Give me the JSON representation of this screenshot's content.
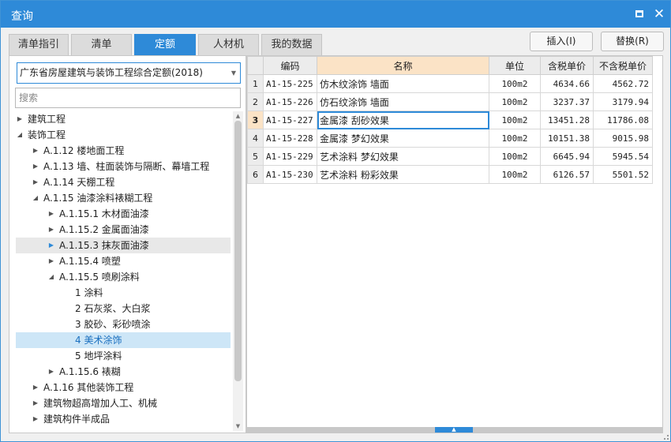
{
  "window": {
    "title": "查询"
  },
  "tabs": [
    {
      "label": "清单指引"
    },
    {
      "label": "清单"
    },
    {
      "label": "定额",
      "active": true
    },
    {
      "label": "人材机"
    },
    {
      "label": "我的数据"
    }
  ],
  "actions": {
    "insert": "插入(I)",
    "replace": "替换(R)"
  },
  "quota_select": {
    "value": "广东省房屋建筑与装饰工程综合定额(2018)"
  },
  "search": {
    "placeholder": "搜索"
  },
  "tree": [
    {
      "label": "建筑工程",
      "level": 0,
      "arrow": "collapsed"
    },
    {
      "label": "装饰工程",
      "level": 0,
      "arrow": "expanded"
    },
    {
      "label": "A.1.12 楼地面工程",
      "level": 1,
      "arrow": "collapsed"
    },
    {
      "label": "A.1.13 墙、柱面装饰与隔断、幕墙工程",
      "level": 1,
      "arrow": "collapsed"
    },
    {
      "label": "A.1.14 天棚工程",
      "level": 1,
      "arrow": "collapsed"
    },
    {
      "label": "A.1.15 油漆涂料裱糊工程",
      "level": 1,
      "arrow": "expanded"
    },
    {
      "label": "A.1.15.1 木材面油漆",
      "level": 2,
      "arrow": "collapsed"
    },
    {
      "label": "A.1.15.2 金属面油漆",
      "level": 2,
      "arrow": "collapsed"
    },
    {
      "label": "A.1.15.3 抹灰面油漆",
      "level": 2,
      "arrow": "collapsed-blue",
      "state": "hover"
    },
    {
      "label": "A.1.15.4 喷塑",
      "level": 2,
      "arrow": "collapsed"
    },
    {
      "label": "A.1.15.5 喷刷涂料",
      "level": 2,
      "arrow": "expanded"
    },
    {
      "label": "1 涂料",
      "level": 3,
      "arrow": "none"
    },
    {
      "label": "2 石灰浆、大白浆",
      "level": 3,
      "arrow": "none"
    },
    {
      "label": "3 胶砂、彩砂喷涂",
      "level": 3,
      "arrow": "none"
    },
    {
      "label": "4 美术涂饰",
      "level": 3,
      "arrow": "none",
      "state": "selected"
    },
    {
      "label": "5 地坪涂料",
      "level": 3,
      "arrow": "none"
    },
    {
      "label": "A.1.15.6 裱糊",
      "level": 2,
      "arrow": "collapsed"
    },
    {
      "label": "A.1.16 其他装饰工程",
      "level": 1,
      "arrow": "collapsed"
    },
    {
      "label": "建筑物超高增加人工、机械",
      "level": 1,
      "arrow": "collapsed"
    },
    {
      "label": "建筑构件半成品",
      "level": 1,
      "arrow": "collapsed"
    }
  ],
  "table": {
    "columns": [
      "",
      "编码",
      "名称",
      "单位",
      "含税单价",
      "不含税单价"
    ],
    "active_column": 2,
    "rows": [
      {
        "idx": "1",
        "code": "A1-15-225",
        "name": "仿木纹涂饰 墙面",
        "unit": "100m2",
        "price_tax": "4634.66",
        "price_notax": "4562.72"
      },
      {
        "idx": "2",
        "code": "A1-15-226",
        "name": "仿石纹涂饰 墙面",
        "unit": "100m2",
        "price_tax": "3237.37",
        "price_notax": "3179.94"
      },
      {
        "idx": "3",
        "code": "A1-15-227",
        "name": "金属漆 刮砂效果",
        "unit": "100m2",
        "price_tax": "13451.28",
        "price_notax": "11786.08",
        "active": true
      },
      {
        "idx": "4",
        "code": "A1-15-228",
        "name": "金属漆 梦幻效果",
        "unit": "100m2",
        "price_tax": "10151.38",
        "price_notax": "9015.98"
      },
      {
        "idx": "5",
        "code": "A1-15-229",
        "name": "艺术涂料 梦幻效果",
        "unit": "100m2",
        "price_tax": "6645.94",
        "price_notax": "5945.54"
      },
      {
        "idx": "6",
        "code": "A1-15-230",
        "name": "艺术涂料 粉彩效果",
        "unit": "100m2",
        "price_tax": "6126.57",
        "price_notax": "5501.52"
      }
    ]
  },
  "colors": {
    "accent": "#2e8ad8",
    "active_header": "#fbe3c6",
    "selected_node": "#cde6f7"
  }
}
